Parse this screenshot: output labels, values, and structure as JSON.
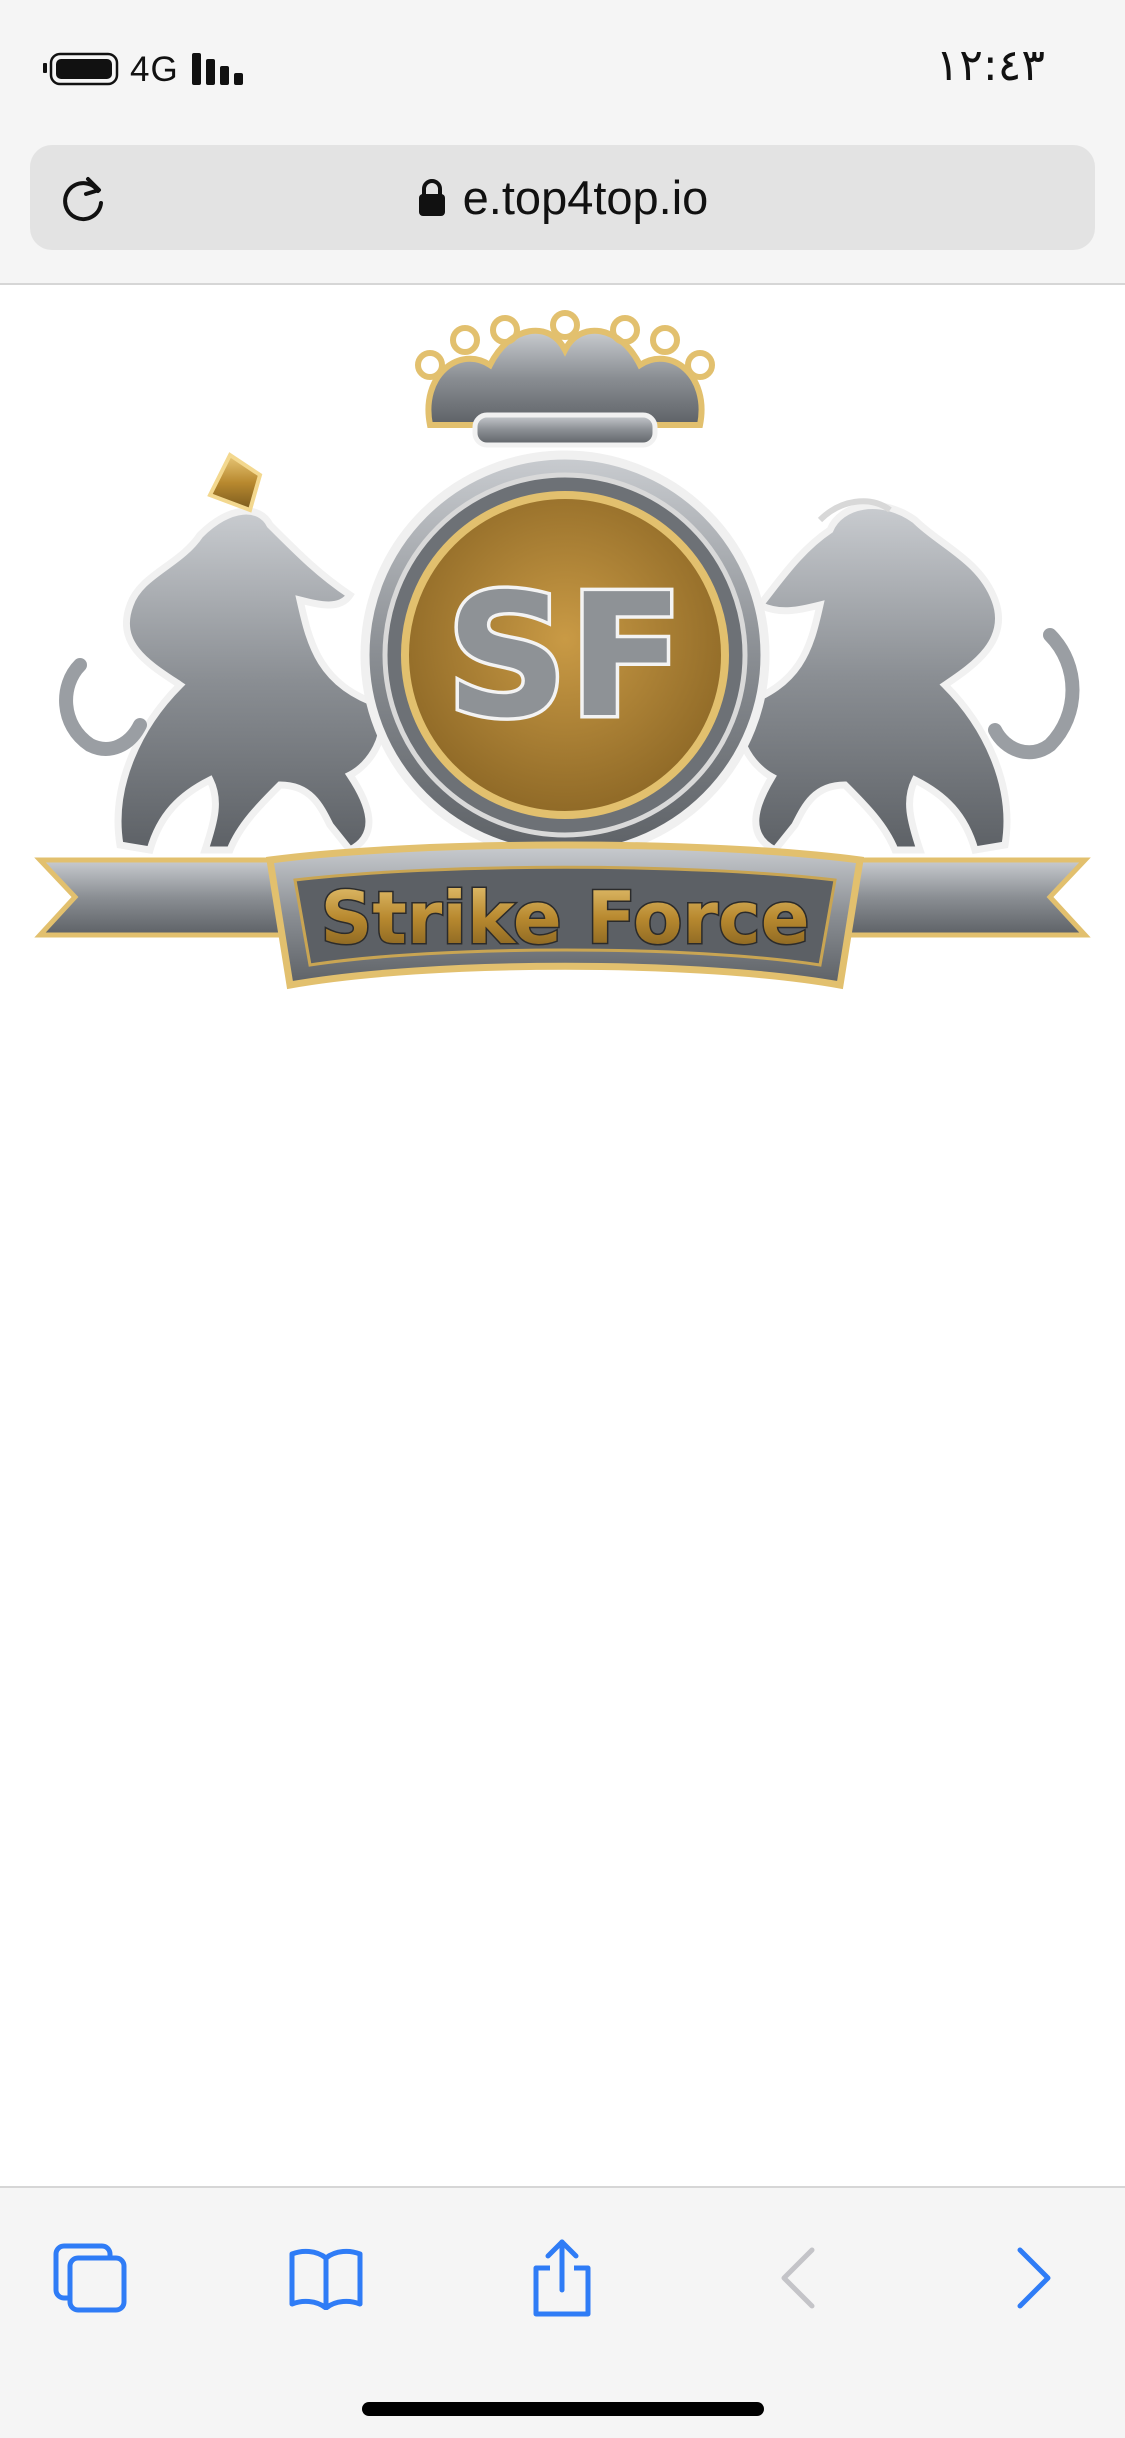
{
  "status_bar": {
    "network": "4G",
    "time": "١٢:٤٣",
    "icons": [
      "battery-icon",
      "signal-bars-icon"
    ]
  },
  "address_bar": {
    "url": "e.top4top.io",
    "icons": [
      "reload-icon",
      "lock-icon"
    ]
  },
  "logo": {
    "initials": "SF",
    "banner_text": "Strike Force",
    "icons": [
      "crown-icon",
      "horse-icon",
      "lion-icon"
    ]
  },
  "toolbar": {
    "items": [
      {
        "name": "tabs",
        "icon": "tabs-icon"
      },
      {
        "name": "bookmarks",
        "icon": "bookmarks-icon"
      },
      {
        "name": "share",
        "icon": "share-icon"
      },
      {
        "name": "back",
        "icon": "back-icon",
        "enabled": false
      },
      {
        "name": "forward",
        "icon": "forward-icon",
        "enabled": true
      }
    ]
  },
  "colors": {
    "accent": "#2f7cf6",
    "disabled": "#c4c4c8",
    "gold": "#b8892f",
    "silver": "#8e9296"
  }
}
